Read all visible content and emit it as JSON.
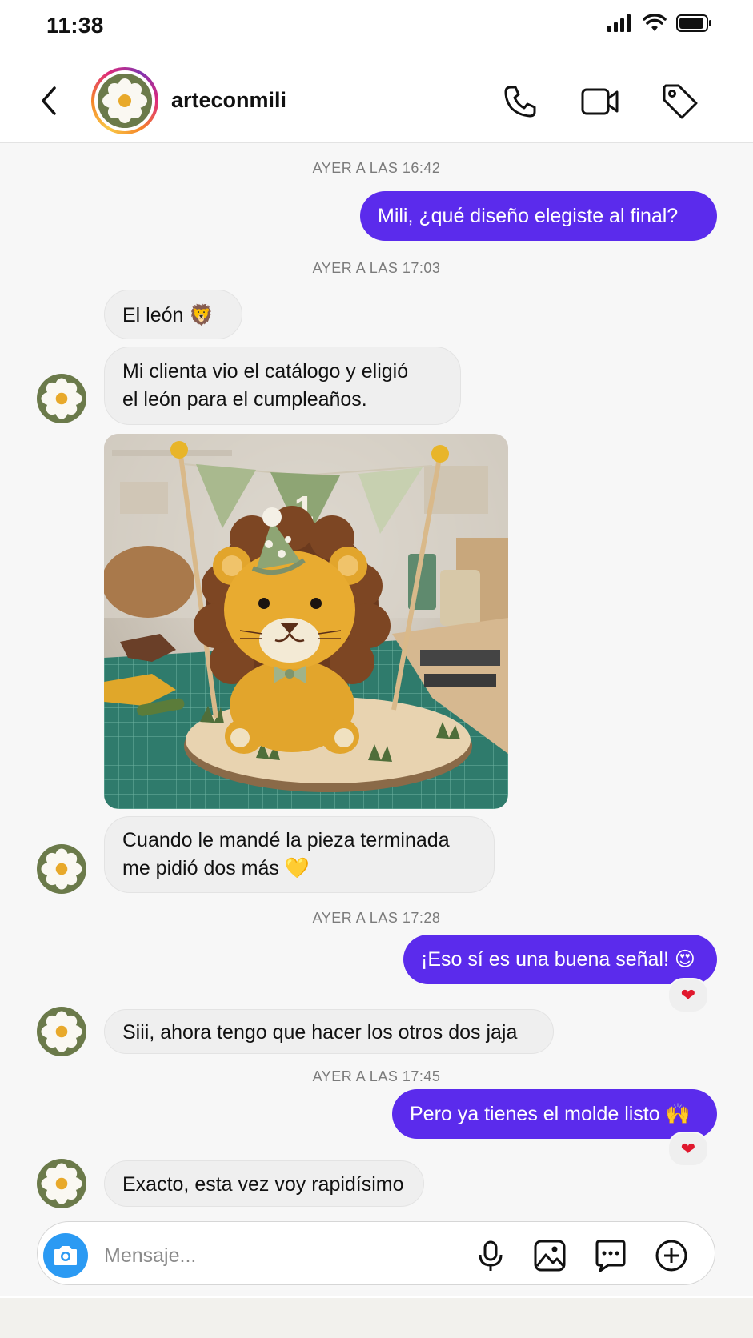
{
  "status": {
    "time": "11:38"
  },
  "header": {
    "username": "arteconmili"
  },
  "messages": {
    "ts1": "AYER A LAS 16:42",
    "m1": "Mili, ¿qué diseño elegiste al final?",
    "ts2": "AYER A LAS 17:03",
    "m2": "El león 🦁",
    "m3a": "Mi clienta vio el catálogo y eligió",
    "m3b": "el león para el cumpleaños.",
    "m4a": "Cuando le mandé la pieza terminada",
    "m4b": "me pidió dos más 💛",
    "ts3": "AYER A LAS 17:28",
    "m5": "¡Eso sí es una buena señal! 😍",
    "m5_reaction": "❤",
    "m6": "Siii, ahora tengo que hacer los otros dos jaja",
    "ts4": "AYER A LAS 17:45",
    "m7": "Pero ya tienes el molde listo 🙌",
    "m7_reaction": "❤",
    "m8": "Exacto, esta vez voy rapidísimo"
  },
  "image_topper_label": "1",
  "composer": {
    "placeholder": "Mensaje..."
  },
  "colors": {
    "outgoing": "#5b2bec",
    "incoming": "#efefef",
    "camera": "#2b9af3"
  },
  "icons": [
    "back-icon",
    "phone-icon",
    "video-icon",
    "tag-icon",
    "camera-icon",
    "mic-icon",
    "gallery-icon",
    "sticker-icon",
    "add-icon"
  ]
}
